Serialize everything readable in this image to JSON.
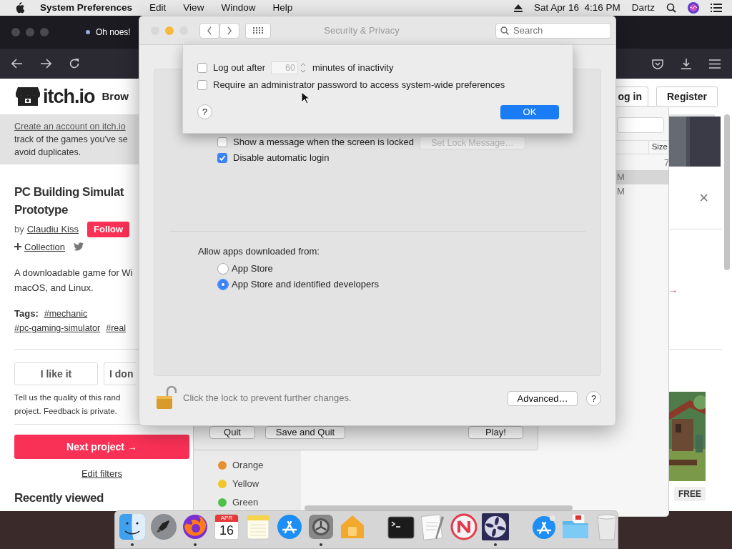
{
  "menubar": {
    "app": "System Preferences",
    "menus": [
      "Edit",
      "View",
      "Window",
      "Help"
    ],
    "clock": "Sat Apr 16  4:16 PM",
    "user": "Dartz"
  },
  "browser": {
    "tab_title": "Oh noes!"
  },
  "itch": {
    "logo": "itch.io",
    "nav": "Brow",
    "login": "og in",
    "register": "Register",
    "banner": [
      "Create an account on itch.io",
      "track of the games you've se",
      "avoid duplicates."
    ],
    "title": [
      "PC Building Simulat",
      "Prototype"
    ],
    "by": "by",
    "author": "Claudiu Kiss",
    "follow": "Follow",
    "collection": "Collection",
    "description": [
      "A downloadable game for Wi",
      "macOS, and Linux."
    ],
    "tags_label": "Tags:",
    "tags": [
      "#mechanic",
      "#pc-gaming-simulator",
      "#real"
    ],
    "like": "I like it",
    "dislike": "I don",
    "feedback": [
      "Tell us the quality of this rand",
      "project. Feedback is private."
    ],
    "next": "Next project →",
    "edit_filters": "Edit filters",
    "recent": "Recently viewed",
    "close": "×",
    "arrow": "→",
    "free": "FREE"
  },
  "finder": {
    "size_column": "Size",
    "size_value": "7",
    "rows": [
      {
        "text": "M",
        "selected": true
      },
      {
        "text": "M",
        "selected": false
      }
    ],
    "tags": [
      {
        "label": "Orange",
        "color": "#e8902f"
      },
      {
        "label": "Yellow",
        "color": "#f0c52a"
      },
      {
        "label": "Green",
        "color": "#4cc14a"
      }
    ],
    "game_buttons": [
      "Quit",
      "Save and Quit",
      "Play!"
    ]
  },
  "prefs": {
    "title": "Security & Privacy",
    "search_placeholder": "Search",
    "options": [
      {
        "label": "Show a message when the screen is locked",
        "checked": false,
        "button": "Set Lock Message…"
      },
      {
        "label": "Disable automatic login",
        "checked": true
      }
    ],
    "allow_label": "Allow apps downloaded from:",
    "sources": [
      {
        "label": "App Store",
        "selected": false
      },
      {
        "label": "App Store and identified developers",
        "selected": true
      }
    ],
    "lock_text": "Click the lock to prevent further changes.",
    "advanced": "Advanced…",
    "help": "?"
  },
  "sheet": {
    "logout": {
      "label": "Log out after",
      "checked": false,
      "value": "60",
      "suffix": "minutes of inactivity"
    },
    "admin": {
      "label": "Require an administrator password to access system-wide preferences",
      "checked": false
    },
    "help": "?",
    "ok": "OK"
  },
  "dock": {
    "items": [
      {
        "kind": "finder",
        "running": true
      },
      {
        "kind": "launchpad",
        "running": false
      },
      {
        "kind": "firefox",
        "running": true
      },
      {
        "kind": "calendar",
        "running": false,
        "month": "APR",
        "day": "16"
      },
      {
        "kind": "notes",
        "running": false
      },
      {
        "kind": "appstore",
        "running": false
      },
      {
        "kind": "sysprefs",
        "running": true
      },
      {
        "kind": "home",
        "running": false
      },
      {
        "kind": "divider"
      },
      {
        "kind": "terminal",
        "running": false
      },
      {
        "kind": "textedit",
        "running": false
      },
      {
        "kind": "news",
        "running": false
      },
      {
        "kind": "fan",
        "running": true
      },
      {
        "kind": "divider"
      },
      {
        "kind": "installer",
        "running": false
      },
      {
        "kind": "folder",
        "running": false
      },
      {
        "kind": "trash",
        "running": false
      }
    ]
  }
}
